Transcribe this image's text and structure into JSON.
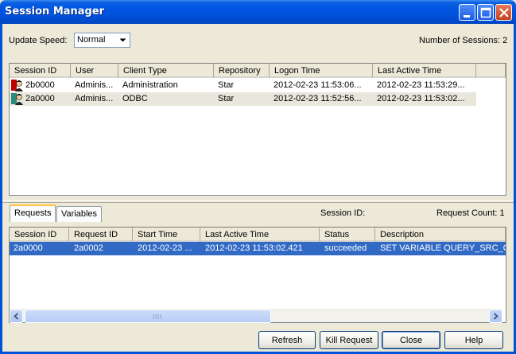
{
  "window": {
    "title": "Session Manager"
  },
  "controls": {
    "update_speed_label": "Update Speed:",
    "update_speed_value": "Normal",
    "num_sessions_label": "Number of Sessions: 2"
  },
  "sessions": {
    "columns": [
      "Session ID",
      "User",
      "Client Type",
      "Repository",
      "Logon Time",
      "Last Active Time"
    ],
    "rows": [
      {
        "session_id": "2b0000",
        "user": "Adminis...",
        "client_type": "Administration",
        "repository": "Star",
        "logon_time": "2012-02-23 11:53:06...",
        "last_active": "2012-02-23 11:53:29..."
      },
      {
        "session_id": "2a0000",
        "user": "Adminis...",
        "client_type": "ODBC",
        "repository": "Star",
        "logon_time": "2012-02-23 11:52:56...",
        "last_active": "2012-02-23 11:53:02..."
      }
    ]
  },
  "tabs": {
    "requests": "Requests",
    "variables": "Variables"
  },
  "request_info": {
    "session_id_label": "Session ID:",
    "request_count_label": "Request Count: 1"
  },
  "requests": {
    "columns": [
      "Session ID",
      "Request ID",
      "Start Time",
      "Last Active Time",
      "Status",
      "Description"
    ],
    "rows": [
      {
        "session_id": "2a0000",
        "request_id": "2a0002",
        "start_time": "2012-02-23 ...",
        "last_active": "2012-02-23 11:53:02.421",
        "status": "succeeded",
        "description": "SET VARIABLE QUERY_SRC_CD="
      }
    ]
  },
  "buttons": {
    "refresh": "Refresh",
    "kill_request": "Kill Request",
    "close": "Close",
    "help": "Help"
  },
  "colors": {
    "titlebar": "#0054e3",
    "selection": "#316ac5",
    "face": "#ece9d8"
  }
}
